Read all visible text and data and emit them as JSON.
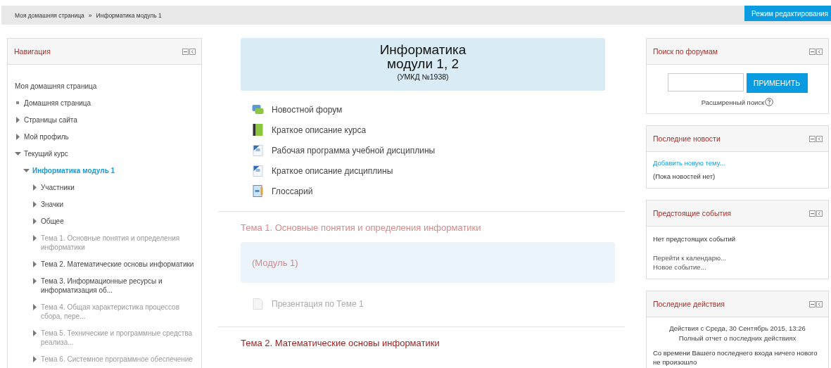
{
  "breadcrumb": {
    "items": [
      {
        "label": "Моя домашняя страница"
      },
      {
        "label": "Информатика модуль 1"
      }
    ],
    "separator": "»"
  },
  "edit_button": "Режим редактирования",
  "navigation": {
    "title": "Навигация",
    "items": [
      {
        "kind": "plain",
        "label": "Моя домашняя страница",
        "selected": false,
        "dimmed": false
      },
      {
        "kind": "bullet",
        "label": "Домашняя страница",
        "selected": false,
        "dimmed": false
      },
      {
        "kind": "branch",
        "label": "Страницы сайта",
        "expanded": false,
        "selected": false,
        "dimmed": false
      },
      {
        "kind": "branch",
        "label": "Мой профиль",
        "expanded": false,
        "selected": false,
        "dimmed": false
      },
      {
        "kind": "branch",
        "label": "Текущий курс",
        "expanded": true,
        "selected": false,
        "dimmed": false,
        "children": [
          {
            "kind": "branch",
            "label": "Информатика модуль 1",
            "expanded": true,
            "selected": true,
            "dimmed": false,
            "children": [
              {
                "kind": "branch",
                "label": "Участники",
                "expanded": false,
                "selected": false,
                "dimmed": false
              },
              {
                "kind": "branch",
                "label": "Значки",
                "expanded": false,
                "selected": false,
                "dimmed": false
              },
              {
                "kind": "branch",
                "label": "Общее",
                "expanded": false,
                "selected": false,
                "dimmed": false
              },
              {
                "kind": "branch",
                "label": "Тема 1. Основные понятия и определения информатики",
                "expanded": false,
                "selected": false,
                "dimmed": true
              },
              {
                "kind": "branch",
                "label": "Тема 2. Математические основы информатики",
                "expanded": false,
                "selected": false,
                "dimmed": false
              },
              {
                "kind": "branch",
                "label": "Тема 3. Информационные ресурсы и информатизация об...",
                "expanded": false,
                "selected": false,
                "dimmed": false
              },
              {
                "kind": "branch",
                "label": "Тема 4. Общая характеристика процессов сбора, пере...",
                "expanded": false,
                "selected": false,
                "dimmed": true
              },
              {
                "kind": "branch",
                "label": "Тема 5. Технические и программные средства реализа...",
                "expanded": false,
                "selected": false,
                "dimmed": true
              },
              {
                "kind": "branch",
                "label": "Тема 6. Системное программное обеспечение",
                "expanded": false,
                "selected": false,
                "dimmed": true
              }
            ]
          }
        ]
      }
    ]
  },
  "course_header": {
    "title": "Информатика",
    "subtitle": "модули 1, 2",
    "code": "(УМКД №1938)"
  },
  "activities": [
    {
      "kind": "forum",
      "label": "Новостной форум",
      "dimmed": false
    },
    {
      "kind": "book",
      "label": "Краткое описание курса",
      "dimmed": false
    },
    {
      "kind": "document",
      "label": "Рабочая программа учебной дисциплины",
      "dimmed": false
    },
    {
      "kind": "document",
      "label": "Краткое описание дисциплины",
      "dimmed": false
    },
    {
      "kind": "glossary",
      "label": "Глоссарий",
      "dimmed": false
    }
  ],
  "sections": [
    {
      "title": "Тема 1. Основные понятия и определения информатики",
      "dimmed": true,
      "summary": "(Модуль 1)",
      "activities": [
        {
          "kind": "file",
          "label": "Презентация по Теме 1",
          "dimmed": true
        }
      ]
    },
    {
      "title": "Тема 2. Математические основы информатики",
      "dimmed": false
    }
  ],
  "blocks": [
    {
      "kind": "search",
      "title": "Поиск по форумам",
      "button": "ПРИМЕНИТЬ",
      "link": "Расширенный поиск"
    },
    {
      "kind": "news",
      "title": "Последние новости",
      "link": "Добавить новую тему...",
      "text": "(Пока новостей нет)"
    },
    {
      "kind": "events",
      "title": "Предстоящие события",
      "text": "Нет предстоящих событий",
      "links": [
        "Перейти к календарю...",
        "Новое событие..."
      ]
    },
    {
      "kind": "recent",
      "title": "Последние действия",
      "lines": [
        "Действия с Среда, 30 Сентябрь 2015, 13:26",
        "Полный отчет о последних действиях"
      ],
      "text": "Со времени Вашего последнего входа ничего нового не произошло"
    }
  ]
}
